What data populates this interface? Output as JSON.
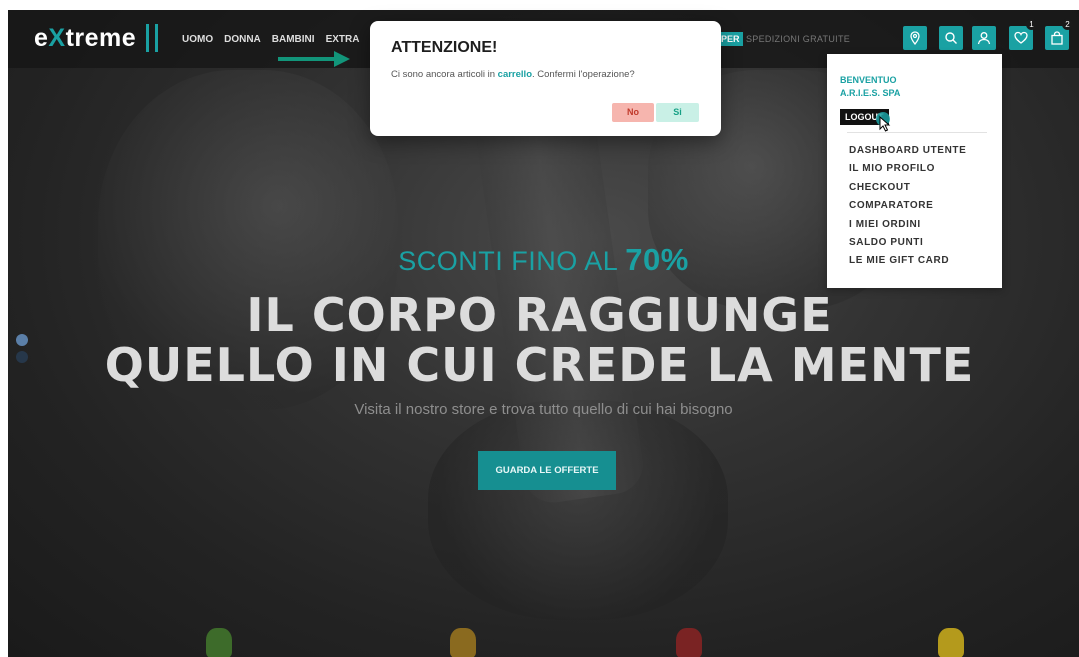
{
  "navbar": {
    "logo_prefix": "e",
    "logo_x": "X",
    "logo_suffix": "treme",
    "menu": [
      "UOMO",
      "DONNA",
      "BAMBINI",
      "EXTRA"
    ],
    "promo_badge": "PER",
    "promo_text": "SPEDIZIONI GRATUITE",
    "wishlist_count": "1",
    "cart_count": "2"
  },
  "modal": {
    "title": "ATTENZIONE!",
    "message_before": "Ci sono ancora articoli in ",
    "message_highlight": "carrello",
    "message_after": ". Confermi l'operazione?",
    "no_label": "No",
    "si_label": "Si"
  },
  "user_menu": {
    "greeting_line1": "BENVENTUO",
    "greeting_line2": "A.R.I.E.S. SPA",
    "logout_label": "LOGOUT",
    "links": [
      "DASHBOARD UTENTE",
      "IL MIO PROFILO",
      "CHECKOUT",
      "COMPARATORE",
      "I MIEI ORDINI",
      "SALDO PUNTI",
      "LE MIE GIFT CARD"
    ]
  },
  "hero": {
    "subtitle_prefix": "SCONTI FINO AL ",
    "subtitle_value": "70%",
    "headline_line1": "IL CORPO RAGGIUNGE",
    "headline_line2": "QUELLO IN CUI CREDE LA MENTE",
    "description": "Visita il nostro store e trova tutto quello di cui hai bisogno",
    "cta_label": "GUARDA LE OFFERTE"
  },
  "colors": {
    "accent": "#1aa1a3",
    "no_button_bg": "#f6b5ae",
    "si_button_bg": "#c9f0e6"
  },
  "icons": [
    "map-pin-icon",
    "search-icon",
    "user-icon",
    "heart-icon",
    "shopping-bag-icon",
    "arrow-right-icon",
    "mouse-pointer-icon"
  ]
}
